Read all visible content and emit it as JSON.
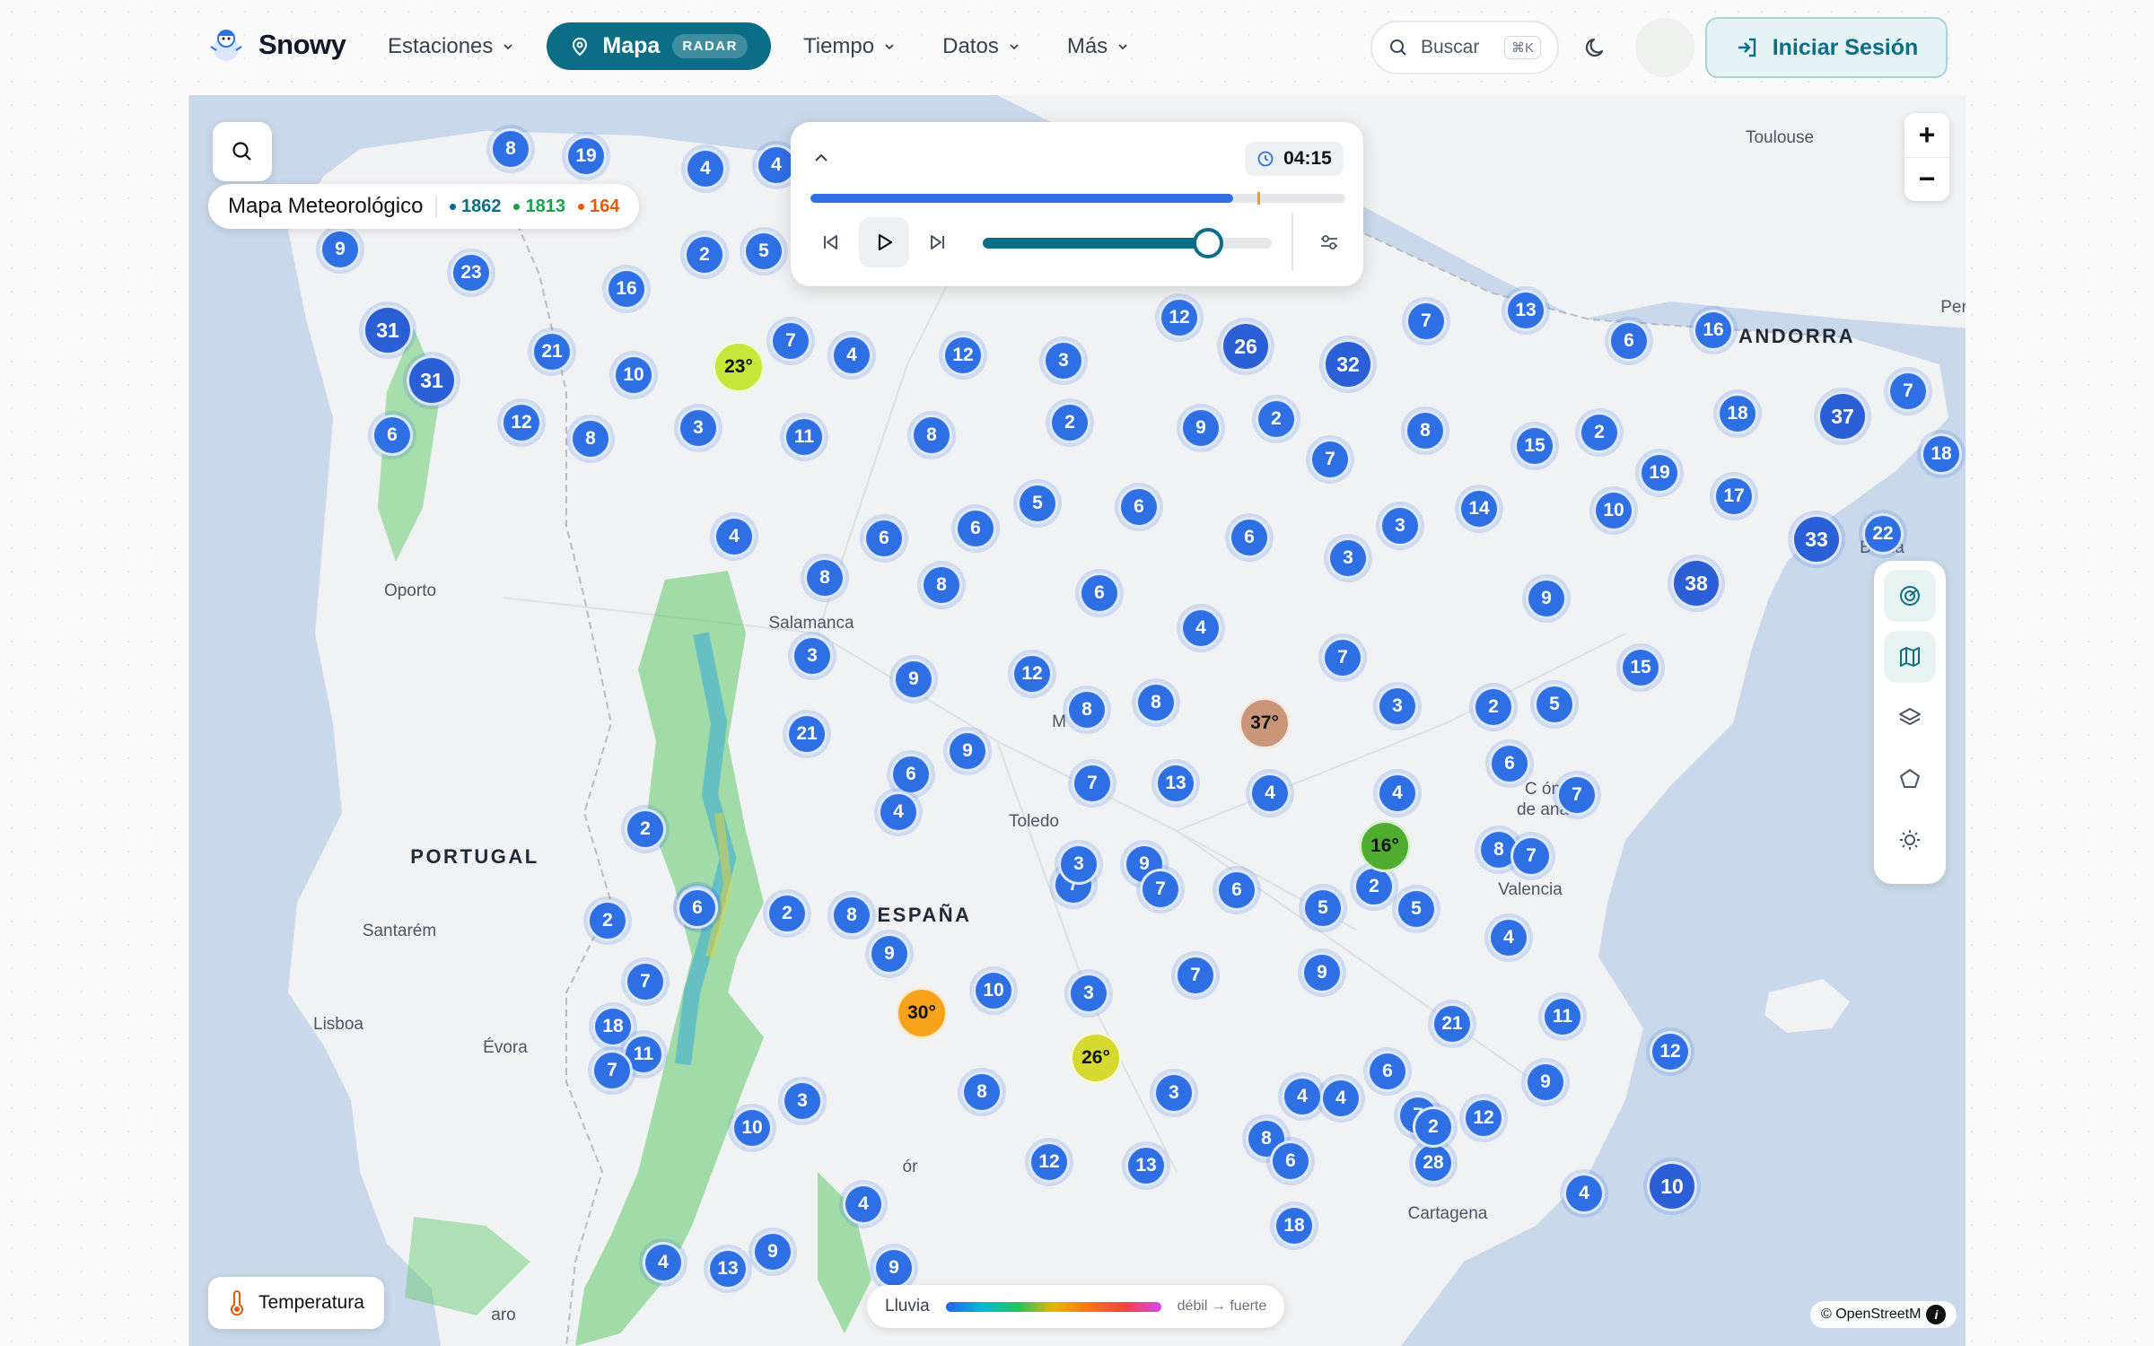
{
  "header": {
    "logo_text": "Snowy",
    "nav": [
      {
        "label": "Estaciones"
      },
      {
        "label": "Mapa",
        "badge": "RADAR",
        "active": true
      },
      {
        "label": "Tiempo"
      },
      {
        "label": "Datos"
      },
      {
        "label": "Más"
      }
    ],
    "search_placeholder": "Buscar",
    "search_shortcut": "⌘K",
    "login_label": "Iniciar Sesión"
  },
  "map": {
    "title": "Mapa Meteorológico",
    "counts": [
      {
        "value": "1862",
        "color": "#0b6e86"
      },
      {
        "value": "1813",
        "color": "#16a34a"
      },
      {
        "value": "164",
        "color": "#ea580c"
      }
    ],
    "player": {
      "time": "04:15",
      "progress_fraction": 0.79,
      "speed_fraction": 0.78
    },
    "legend": {
      "label": "Lluvia",
      "range": "débil → fuerte"
    },
    "temperature_button": "Temperatura",
    "attribution": "© OpenStreetM",
    "places": [
      {
        "name": "Toulouse"
      },
      {
        "name": "ANDORRA"
      },
      {
        "name": "Oporto"
      },
      {
        "name": "Salamanca"
      },
      {
        "name": "PORTUGAL"
      },
      {
        "name": "ESPAÑA"
      },
      {
        "name": "Toledo"
      },
      {
        "name": "Santarém"
      },
      {
        "name": "Lisboa"
      },
      {
        "name": "Évora"
      },
      {
        "name": "Valencia"
      },
      {
        "name": "Cartagena"
      },
      {
        "name": "C     ón"
      },
      {
        "name": "de      ana"
      },
      {
        "name": "Ba      na"
      },
      {
        "name": "M"
      },
      {
        "name": "Per"
      },
      {
        "name": "aro"
      },
      {
        "name": "ór"
      }
    ],
    "clusters": [
      "8",
      "19",
      "4",
      "4",
      "9",
      "23",
      "16",
      "2",
      "5",
      "31",
      "31",
      "21",
      "10",
      "7",
      "4",
      "12",
      "3",
      "12",
      "26",
      "32",
      "7",
      "13",
      "6",
      "16",
      "6",
      "12",
      "8",
      "3",
      "11",
      "8",
      "2",
      "9",
      "2",
      "7",
      "8",
      "15",
      "2",
      "18",
      "37",
      "7",
      "18",
      "19",
      "4",
      "6",
      "6",
      "5",
      "6",
      "6",
      "3",
      "3",
      "14",
      "10",
      "17",
      "33",
      "22",
      "38",
      "8",
      "8",
      "6",
      "4",
      "9",
      "3",
      "9",
      "12",
      "8",
      "8",
      "7",
      "3",
      "2",
      "5",
      "15",
      "21",
      "6",
      "9",
      "7",
      "13",
      "4",
      "4",
      "6",
      "7",
      "2",
      "4",
      "7",
      "9",
      "2",
      "6",
      "3",
      "7",
      "8",
      "2",
      "6",
      "5",
      "5",
      "7",
      "8",
      "9",
      "2",
      "6",
      "7",
      "10",
      "3",
      "7",
      "9",
      "4",
      "21",
      "11",
      "18",
      "11",
      "3",
      "7",
      "8",
      "3",
      "4",
      "4",
      "7",
      "12",
      "12",
      "6",
      "8",
      "10",
      "12",
      "13",
      "6",
      "28",
      "2",
      "9",
      "10",
      "4",
      "18",
      "4",
      "9",
      "4",
      "13",
      "9"
    ],
    "temps": [
      {
        "label": "23°",
        "color": "#c6e63a"
      },
      {
        "label": "37°",
        "color": "#c9967a"
      },
      {
        "label": "16°",
        "color": "#4fae2f"
      },
      {
        "label": "30°",
        "color": "#f6a21a"
      },
      {
        "label": "26°",
        "color": "#d6d92f"
      }
    ]
  }
}
